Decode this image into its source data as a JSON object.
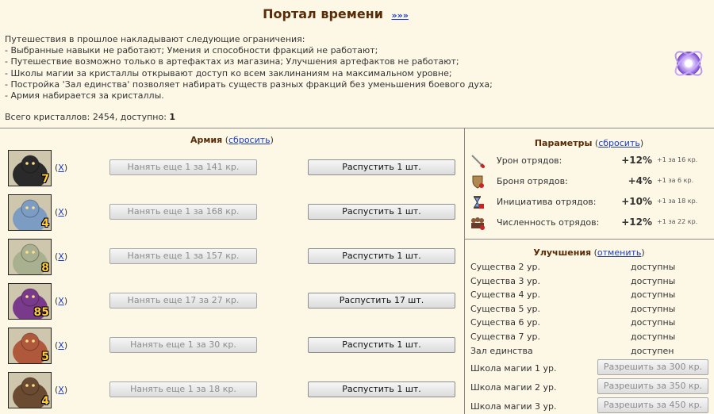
{
  "header": {
    "title": "Портал времени",
    "link": "»»»"
  },
  "intro": {
    "lines": [
      "Путешествия в прошлое накладывают следующие ограничения:",
      "- Выбранные навыки не работают; Умения и способности фракций не работают;",
      "- Путешествие возможно только в артефактах из магазина; Улучшения артефактов не работают;",
      "- Школы магии за кристаллы открывают доступ ко всем заклинаниям на максимальном уровне;",
      "- Постройка 'Зал единства' позволяет набирать существ разных фракций без уменьшения боевого духа;",
      "- Армия набирается за кристаллы."
    ],
    "total_label": "Всего кристаллов: 2454, доступно: ",
    "available": "1"
  },
  "army": {
    "title": "Армия",
    "open_paren": " (",
    "reset_label": "сбросить",
    "close_paren": ")",
    "remove_label": "X",
    "units": [
      {
        "count": "7",
        "hire_label": "Нанять еще 1 за 141 кр.",
        "dismiss_label": "Распустить 1 шт.",
        "color": "#2a2a2a"
      },
      {
        "count": "4",
        "hire_label": "Нанять еще 1 за 168 кр.",
        "dismiss_label": "Распустить 1 шт.",
        "color": "#7d9cc4"
      },
      {
        "count": "8",
        "hire_label": "Нанять еще 1 за 157 кр.",
        "dismiss_label": "Распустить 1 шт.",
        "color": "#a8b090"
      },
      {
        "count": "85",
        "hire_label": "Нанять еще 17 за 27 кр.",
        "dismiss_label": "Распустить 17 шт.",
        "color": "#7a3a8c"
      },
      {
        "count": "5",
        "hire_label": "Нанять еще 1 за 30 кр.",
        "dismiss_label": "Распустить 1 шт.",
        "color": "#b0583c"
      },
      {
        "count": "4",
        "hire_label": "Нанять еще 1 за 18 кр.",
        "dismiss_label": "Распустить 1 шт.",
        "color": "#6a4a30"
      }
    ]
  },
  "parameters": {
    "title": "Параметры",
    "open_paren": " (",
    "reset_label": "сбросить",
    "close_paren": ")",
    "items": [
      {
        "icon": "sword-icon",
        "label": "Урон отрядов:",
        "value": "+12%",
        "cost": "+1 за 16 кр."
      },
      {
        "icon": "shield-icon",
        "label": "Броня отрядов:",
        "value": "+4%",
        "cost": "+1 за 6 кр."
      },
      {
        "icon": "hourglass-icon",
        "label": "Инициатива отрядов:",
        "value": "+10%",
        "cost": "+1 за 18 кр."
      },
      {
        "icon": "group-icon",
        "label": "Численность отрядов:",
        "value": "+12%",
        "cost": "+1 за 22 кр."
      }
    ]
  },
  "upgrades": {
    "title": "Улучшения",
    "open_paren": " (",
    "cancel_label": "отменить",
    "close_paren": ")",
    "items": [
      {
        "label": "Существа 2 ур.",
        "status": "доступны"
      },
      {
        "label": "Существа 3 ур.",
        "status": "доступны"
      },
      {
        "label": "Существа 4 ур.",
        "status": "доступны"
      },
      {
        "label": "Существа 5 ур.",
        "status": "доступны"
      },
      {
        "label": "Существа 6 ур.",
        "status": "доступны"
      },
      {
        "label": "Существа 7 ур.",
        "status": "доступны"
      },
      {
        "label": "Зал единства",
        "status": "доступен"
      }
    ],
    "magic": [
      {
        "label": "Школа магии 1 ур.",
        "button": "Разрешить за 300 кр."
      },
      {
        "label": "Школа магии 2 ур.",
        "button": "Разрешить за 350 кр."
      },
      {
        "label": "Школа магии 3 ур.",
        "button": "Разрешить за 450 кр."
      }
    ]
  }
}
